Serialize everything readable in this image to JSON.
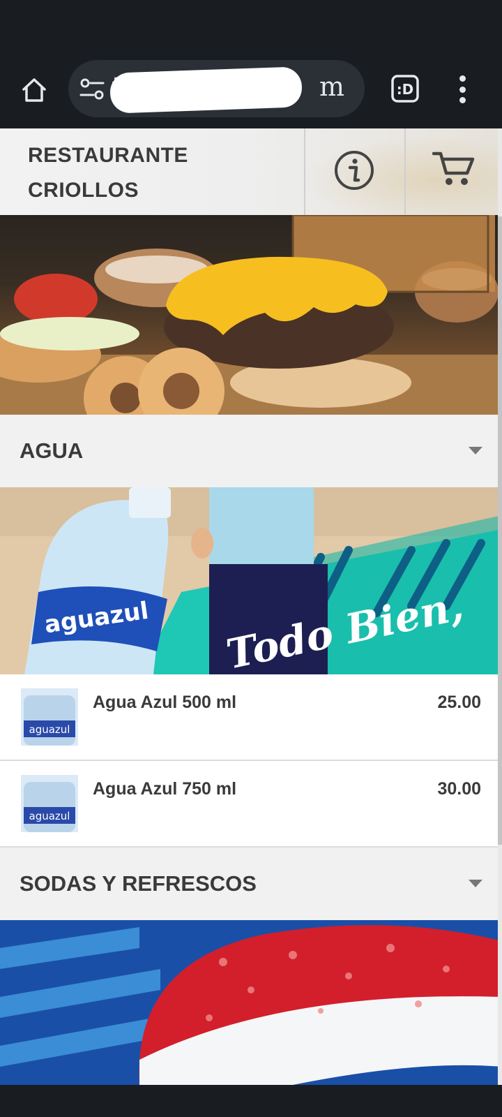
{
  "browser": {
    "url_visible_text": "ta",
    "url_visible_suffix": "m",
    "icons": [
      "home-icon",
      "site-settings-icon",
      "tab-switcher-icon",
      "overflow-menu-icon"
    ]
  },
  "header": {
    "brand_line1": "RESTAURANTE",
    "brand_line2": "CRIOLLOS",
    "icons": [
      "info-icon",
      "cart-icon"
    ]
  },
  "categories": [
    {
      "title": "AGUA",
      "banner": {
        "brand_text": "aguazul",
        "slogan": "Todo Bien,"
      },
      "items": [
        {
          "name": "Agua Azul 500 ml",
          "price": "25.00",
          "thumb_text": "aguazul"
        },
        {
          "name": "Agua Azul 750 ml",
          "price": "30.00",
          "thumb_text": "aguazul"
        }
      ]
    },
    {
      "title": "SODAS Y REFRESCOS"
    }
  ],
  "colors": {
    "chrome_bg": "#191c20",
    "url_bar_bg": "#2b3036",
    "category_bg": "#f1f1f1",
    "text_dark": "#3a3a3a",
    "aguazul_blue": "#1f4fb8",
    "teal_accent": "#1ec8b4",
    "pepsi_red": "#d21f2b"
  }
}
